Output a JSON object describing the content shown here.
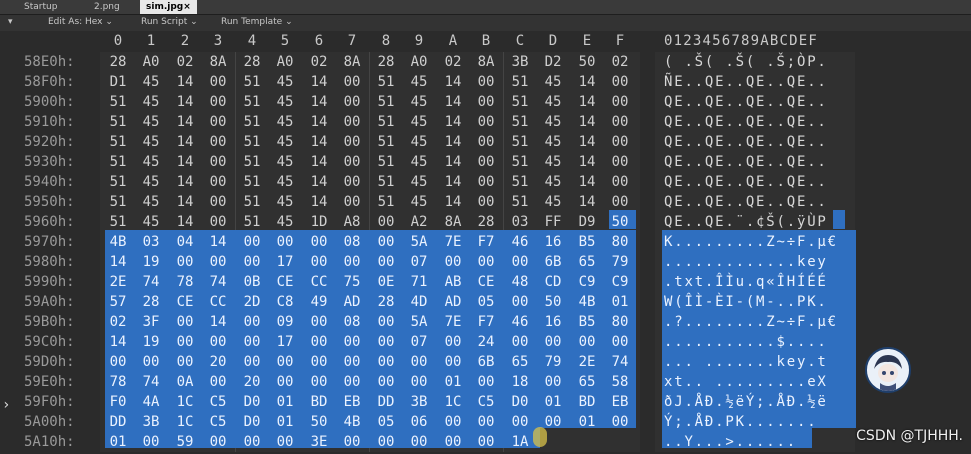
{
  "tabs": [
    {
      "label": "Startup"
    },
    {
      "label": "2.png"
    },
    {
      "label": "sim.jpg"
    }
  ],
  "close_glyph": "×",
  "toolbar": {
    "edit_as": "Edit As: Hex",
    "run_script": "Run Script",
    "run_template": "Run Template"
  },
  "header": {
    "columns": [
      "0",
      "1",
      "2",
      "3",
      "4",
      "5",
      "6",
      "7",
      "8",
      "9",
      "A",
      "B",
      "C",
      "D",
      "E",
      "F"
    ],
    "ascii_header": "0123456789ABCDEF"
  },
  "rows": [
    {
      "addr": "58E0h:",
      "hex": [
        "28",
        "A0",
        "02",
        "8A",
        "28",
        "A0",
        "02",
        "8A",
        "28",
        "A0",
        "02",
        "8A",
        "3B",
        "D2",
        "50",
        "02"
      ],
      "ascii": "( .Š( .Š( .Š;ÒP."
    },
    {
      "addr": "58F0h:",
      "hex": [
        "D1",
        "45",
        "14",
        "00",
        "51",
        "45",
        "14",
        "00",
        "51",
        "45",
        "14",
        "00",
        "51",
        "45",
        "14",
        "00"
      ],
      "ascii": "ÑE..QE..QE..QE.."
    },
    {
      "addr": "5900h:",
      "hex": [
        "51",
        "45",
        "14",
        "00",
        "51",
        "45",
        "14",
        "00",
        "51",
        "45",
        "14",
        "00",
        "51",
        "45",
        "14",
        "00"
      ],
      "ascii": "QE..QE..QE..QE.."
    },
    {
      "addr": "5910h:",
      "hex": [
        "51",
        "45",
        "14",
        "00",
        "51",
        "45",
        "14",
        "00",
        "51",
        "45",
        "14",
        "00",
        "51",
        "45",
        "14",
        "00"
      ],
      "ascii": "QE..QE..QE..QE.."
    },
    {
      "addr": "5920h:",
      "hex": [
        "51",
        "45",
        "14",
        "00",
        "51",
        "45",
        "14",
        "00",
        "51",
        "45",
        "14",
        "00",
        "51",
        "45",
        "14",
        "00"
      ],
      "ascii": "QE..QE..QE..QE.."
    },
    {
      "addr": "5930h:",
      "hex": [
        "51",
        "45",
        "14",
        "00",
        "51",
        "45",
        "14",
        "00",
        "51",
        "45",
        "14",
        "00",
        "51",
        "45",
        "14",
        "00"
      ],
      "ascii": "QE..QE..QE..QE.."
    },
    {
      "addr": "5940h:",
      "hex": [
        "51",
        "45",
        "14",
        "00",
        "51",
        "45",
        "14",
        "00",
        "51",
        "45",
        "14",
        "00",
        "51",
        "45",
        "14",
        "00"
      ],
      "ascii": "QE..QE..QE..QE.."
    },
    {
      "addr": "5950h:",
      "hex": [
        "51",
        "45",
        "14",
        "00",
        "51",
        "45",
        "14",
        "00",
        "51",
        "45",
        "14",
        "00",
        "51",
        "45",
        "14",
        "00"
      ],
      "ascii": "QE..QE..QE..QE.."
    },
    {
      "addr": "5960h:",
      "hex": [
        "51",
        "45",
        "14",
        "00",
        "51",
        "45",
        "1D",
        "A8",
        "00",
        "A2",
        "8A",
        "28",
        "03",
        "FF",
        "D9",
        "50"
      ],
      "ascii": "QE..QE.¨.¢Š(.ÿÙP"
    },
    {
      "addr": "5970h:",
      "hex": [
        "4B",
        "03",
        "04",
        "14",
        "00",
        "00",
        "00",
        "08",
        "00",
        "5A",
        "7E",
        "F7",
        "46",
        "16",
        "B5",
        "80"
      ],
      "ascii": "K.........Z~÷F.µ€"
    },
    {
      "addr": "5980h:",
      "hex": [
        "14",
        "19",
        "00",
        "00",
        "00",
        "17",
        "00",
        "00",
        "00",
        "07",
        "00",
        "00",
        "00",
        "6B",
        "65",
        "79"
      ],
      "ascii": ".............key"
    },
    {
      "addr": "5990h:",
      "hex": [
        "2E",
        "74",
        "78",
        "74",
        "0B",
        "CE",
        "CC",
        "75",
        "0E",
        "71",
        "AB",
        "CE",
        "48",
        "CD",
        "C9",
        "C9"
      ],
      "ascii": ".txt.ÎÌu.q«ÎHÍÉÉ"
    },
    {
      "addr": "59A0h:",
      "hex": [
        "57",
        "28",
        "CE",
        "CC",
        "2D",
        "C8",
        "49",
        "AD",
        "28",
        "4D",
        "AD",
        "05",
        "00",
        "50",
        "4B",
        "01"
      ],
      "ascii": "W(ÎÌ-ÈI-(M-..PK."
    },
    {
      "addr": "59B0h:",
      "hex": [
        "02",
        "3F",
        "00",
        "14",
        "00",
        "09",
        "00",
        "08",
        "00",
        "5A",
        "7E",
        "F7",
        "46",
        "16",
        "B5",
        "80"
      ],
      "ascii": ".?........Z~÷F.µ€"
    },
    {
      "addr": "59C0h:",
      "hex": [
        "14",
        "19",
        "00",
        "00",
        "00",
        "17",
        "00",
        "00",
        "00",
        "07",
        "00",
        "24",
        "00",
        "00",
        "00",
        "00"
      ],
      "ascii": "...........$...."
    },
    {
      "addr": "59D0h:",
      "hex": [
        "00",
        "00",
        "00",
        "20",
        "00",
        "00",
        "00",
        "00",
        "00",
        "00",
        "00",
        "6B",
        "65",
        "79",
        "2E",
        "74"
      ],
      "ascii": "... .......key.t"
    },
    {
      "addr": "59E0h:",
      "hex": [
        "78",
        "74",
        "0A",
        "00",
        "20",
        "00",
        "00",
        "00",
        "00",
        "00",
        "01",
        "00",
        "18",
        "00",
        "65",
        "58"
      ],
      "ascii": "xt.. .........eX"
    },
    {
      "addr": "59F0h:",
      "hex": [
        "F0",
        "4A",
        "1C",
        "C5",
        "D0",
        "01",
        "BD",
        "EB",
        "DD",
        "3B",
        "1C",
        "C5",
        "D0",
        "01",
        "BD",
        "EB"
      ],
      "ascii": "ðJ.ÅÐ.½ëÝ;.ÅÐ.½ë"
    },
    {
      "addr": "5A00h:",
      "hex": [
        "DD",
        "3B",
        "1C",
        "C5",
        "D0",
        "01",
        "50",
        "4B",
        "05",
        "06",
        "00",
        "00",
        "00",
        "00",
        "01",
        "00"
      ],
      "ascii": "Ý;.ÅÐ.PK......."
    },
    {
      "addr": "5A10h:",
      "hex": [
        "01",
        "00",
        "59",
        "00",
        "00",
        "00",
        "3E",
        "00",
        "00",
        "00",
        "00",
        "00",
        "1A",
        "",
        "",
        ""
      ],
      "ascii": "..Y...>......"
    }
  ],
  "watermark": "CSDN @TJHHH."
}
